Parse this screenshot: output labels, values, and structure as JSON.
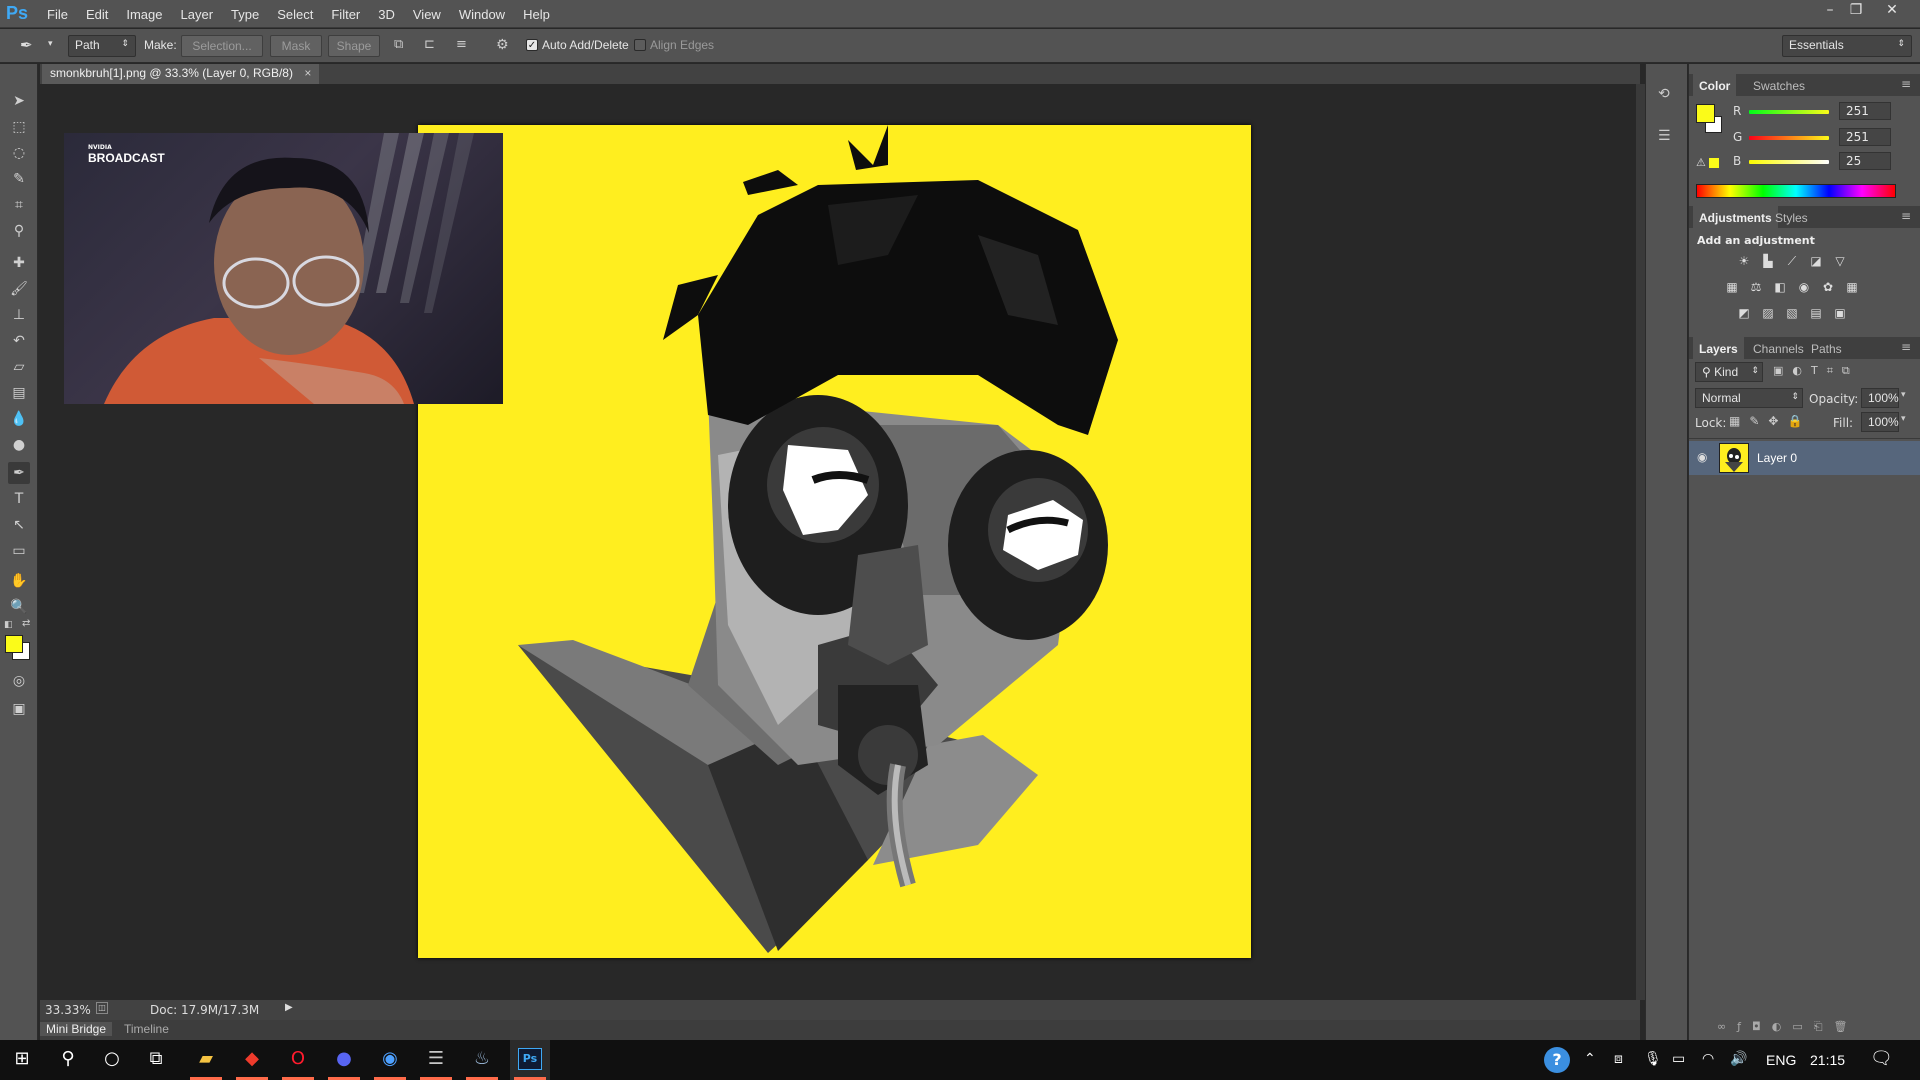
{
  "app": {
    "logo": "Ps",
    "accent": "#3fa9f5"
  },
  "menu": [
    "File",
    "Edit",
    "Image",
    "Layer",
    "Type",
    "Select",
    "Filter",
    "3D",
    "View",
    "Window",
    "Help"
  ],
  "window_controls": {
    "minimize": "–",
    "restore": "❐",
    "close": "✕"
  },
  "options": {
    "tool_mode": "Path",
    "make_label": "Make:",
    "selection_btn": "Selection...",
    "mask_btn": "Mask",
    "shape_btn": "Shape",
    "auto_add_delete": "Auto Add/Delete",
    "align_edges": "Align Edges",
    "workspace": "Essentials"
  },
  "document": {
    "tab_title": "smonkbruh[1].png @ 33.3% (Layer 0, RGB/8)",
    "close": "×",
    "canvas_color": "#ffee1f"
  },
  "webcam": {
    "overlay_brand_small": "NVIDIA",
    "overlay_brand": "BROADCAST"
  },
  "status": {
    "zoom": "33.33%",
    "doc": "Doc: 17.9M/17.3M"
  },
  "bottom_tabs": [
    "Mini Bridge",
    "Timeline"
  ],
  "color_panel": {
    "tabs": [
      "Color",
      "Swatches"
    ],
    "fg": "#fbfb19",
    "r_label": "R",
    "g_label": "G",
    "b_label": "B",
    "r": "251",
    "g": "251",
    "b": "25"
  },
  "adjustments_panel": {
    "tabs": [
      "Adjustments",
      "Styles"
    ],
    "heading": "Add an adjustment",
    "icons": [
      "brightness-icon",
      "levels-icon",
      "curves-icon",
      "exposure-icon",
      "vibrance-icon",
      "hue-sat-icon",
      "color-balance-icon",
      "bw-icon",
      "photo-filter-icon",
      "channel-mixer-icon",
      "color-lookup-icon",
      "invert-icon",
      "posterize-icon",
      "threshold-icon",
      "gradient-map-icon",
      "selective-color-icon"
    ]
  },
  "layers_panel": {
    "tabs": [
      "Layers",
      "Channels",
      "Paths"
    ],
    "kind": "Kind",
    "blend_mode": "Normal",
    "opacity_label": "Opacity:",
    "opacity": "100%",
    "lock_label": "Lock:",
    "fill_label": "Fill:",
    "fill": "100%",
    "layers": [
      {
        "name": "Layer 0"
      }
    ]
  },
  "taskbar": {
    "lang": "ENG",
    "time": "21:15"
  }
}
